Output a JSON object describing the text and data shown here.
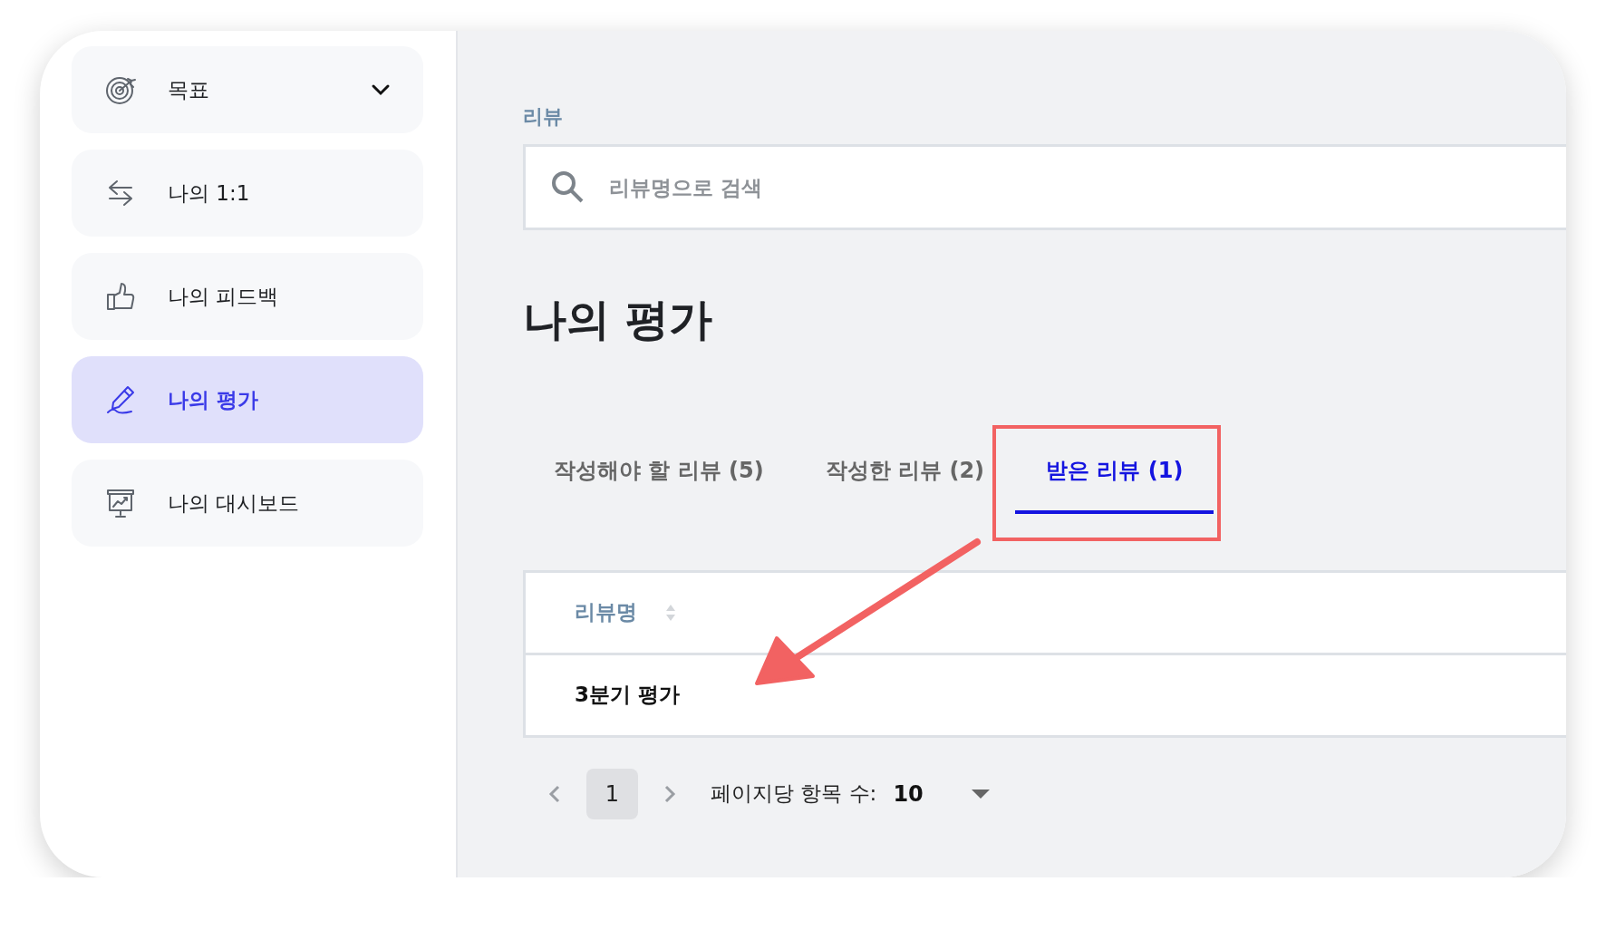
{
  "sidebar": {
    "items": [
      {
        "label": "목표",
        "kind": "target",
        "dropdown": true,
        "selected": false
      },
      {
        "label": "나의 1:1",
        "kind": "exchange",
        "dropdown": false,
        "selected": false
      },
      {
        "label": "나의 피드백",
        "kind": "thumb",
        "dropdown": false,
        "selected": false
      },
      {
        "label": "나의 평가",
        "kind": "pen",
        "dropdown": false,
        "selected": true
      },
      {
        "label": "나의 대시보드",
        "kind": "board",
        "dropdown": false,
        "selected": false
      }
    ]
  },
  "section_label": "리뷰",
  "search": {
    "placeholder": "리뷰명으로 검색"
  },
  "title": "나의 평가",
  "tabs": [
    {
      "label": "작성해야 할 리뷰 (5)",
      "selected": false
    },
    {
      "label": "작성한 리뷰 (2)",
      "selected": false
    },
    {
      "label": "받은 리뷰 (1)",
      "selected": true
    }
  ],
  "table": {
    "columns": [
      {
        "label": "리뷰명",
        "sortable": true
      }
    ],
    "rows": [
      [
        "3분기 평가"
      ]
    ]
  },
  "pagination": {
    "pages": [
      {
        "label": "1",
        "selected": true
      }
    ],
    "per_page_label": "페이지당 항목 수:",
    "per_page_value": "10"
  }
}
